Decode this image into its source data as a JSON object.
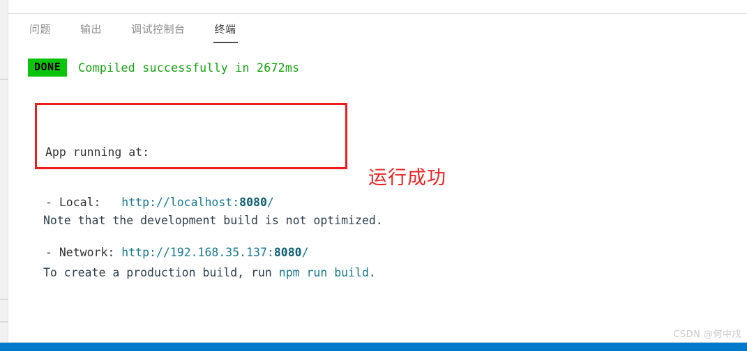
{
  "window": {
    "accent_color": "#007acc",
    "panel_background": "#ffffff",
    "strip_background": "#f1f1f1"
  },
  "tabs": [
    {
      "label": "问题",
      "active": false
    },
    {
      "label": "输出",
      "active": false
    },
    {
      "label": "调试控制台",
      "active": false
    },
    {
      "label": "终端",
      "active": true
    }
  ],
  "terminal": {
    "status_badge": {
      "label": "DONE",
      "background": "#0bc40b",
      "text_color": "#000000"
    },
    "compile_message": "Compiled successfully in 2672ms",
    "compile_color": "#13a10e",
    "app_running": {
      "heading": "App running at:",
      "local_label": "- Local:  ",
      "local_url_prefix": " http://localhost:",
      "local_port": "8080",
      "local_url_suffix": "/",
      "network_label": "- Network:",
      "network_url_prefix": " http://192.168.35.137:",
      "network_port": "8080",
      "network_url_suffix": "/",
      "url_color": "#17788f",
      "box_border_color": "#ee1c1c"
    },
    "note": {
      "line1": "Note that the development build is not optimized.",
      "line2_prefix": "To create a production build, run ",
      "line2_command": "npm run build",
      "line2_suffix": ".",
      "command_color": "#17788f"
    }
  },
  "annotation": {
    "text": "运行成功",
    "color": "#ec2222"
  },
  "watermark": {
    "text": "CSDN @何中戌"
  }
}
